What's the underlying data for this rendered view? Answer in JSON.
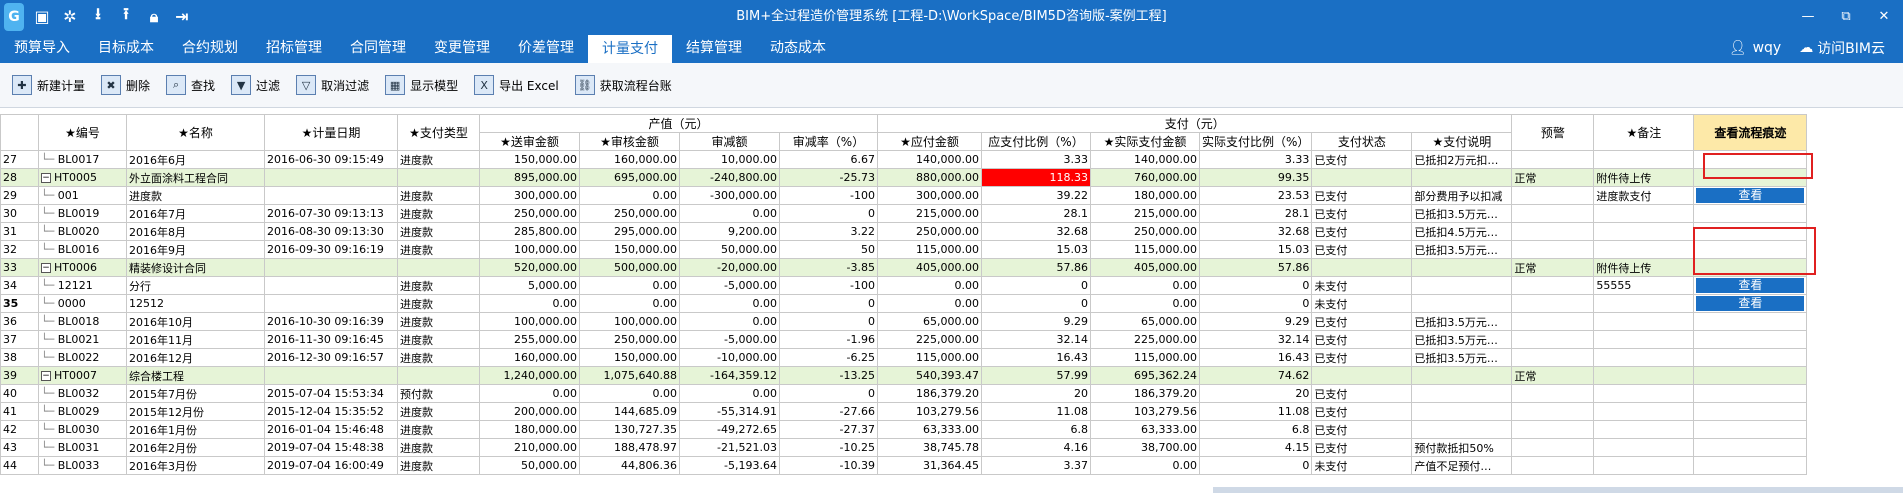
{
  "titlebar": {
    "title": "BIM+全过程造价管理系统 [工程-D:\\WorkSpace/BIM5D咨询版-案例工程]",
    "quick_access": [
      "logo-icon",
      "save-icon",
      "settings-icon",
      "download-icon",
      "upload-icon",
      "lock-icon",
      "exit-icon"
    ],
    "window_buttons": [
      "—",
      "⧉",
      "✕"
    ]
  },
  "menu": {
    "items": [
      "预算导入",
      "目标成本",
      "合约规划",
      "招标管理",
      "合同管理",
      "变更管理",
      "价差管理",
      "计量支付",
      "结算管理",
      "动态成本"
    ],
    "active": "计量支付",
    "user": "wqy",
    "visit": "访问BIM云"
  },
  "toolbar": {
    "buttons": [
      {
        "label": "新建计量",
        "icon": "new-icon"
      },
      {
        "label": "删除",
        "icon": "delete-icon"
      },
      {
        "label": "查找",
        "icon": "find-icon"
      },
      {
        "label": "过滤",
        "icon": "filter-icon"
      },
      {
        "label": "取消过滤",
        "icon": "cancel-filter-icon"
      },
      {
        "label": "显示模型",
        "icon": "model-icon"
      },
      {
        "label": "导出 Excel",
        "icon": "excel-icon"
      },
      {
        "label": "获取流程台账",
        "icon": "workflow-icon"
      }
    ]
  },
  "grid": {
    "group_headers": {
      "output": "产值（元）",
      "payment": "支付（元）"
    },
    "headers": [
      "★编号",
      "★名称",
      "★计量日期",
      "★支付类型",
      "★送审金额",
      "★审核金额",
      "审减额",
      "审减率（%）",
      "★应付金额",
      "应支付比例（%）",
      "★实际支付金额",
      "实际支付比例（%）",
      "支付状态",
      "★支付说明",
      "预警",
      "★备注",
      "查看流程痕迹"
    ],
    "rows": [
      {
        "n": "27",
        "code": "BL0017",
        "name": "2016年6月",
        "date": "2016-06-30 09:15:49",
        "type": "进度款",
        "sub": "150,000.00",
        "aud": "160,000.00",
        "red": "10,000.00",
        "rate": "6.67",
        "pay": "140,000.00",
        "pr": "3.33",
        "act": "140,000.00",
        "ar": "3.33",
        "status": "已支付",
        "desc": "已抵扣2万元扣…",
        "warn": "",
        "note": "",
        "btn": "",
        "group": false
      },
      {
        "n": "28",
        "code": "HT0005",
        "name": "外立面涂料工程合同",
        "date": "",
        "type": "",
        "sub": "895,000.00",
        "aud": "695,000.00",
        "red": "-240,800.00",
        "rate": "-25.73",
        "pay": "880,000.00",
        "pr": "118.33",
        "act": "760,000.00",
        "ar": "99.35",
        "status": "",
        "desc": "",
        "warn": "正常",
        "note": "附件待上传",
        "btn": "",
        "group": true
      },
      {
        "n": "29",
        "code": "001",
        "name": "进度款",
        "date": "",
        "type": "进度款",
        "sub": "300,000.00",
        "aud": "0.00",
        "red": "-300,000.00",
        "rate": "-100",
        "pay": "300,000.00",
        "pr": "39.22",
        "act": "180,000.00",
        "ar": "23.53",
        "status": "已支付",
        "desc": "部分费用予以扣减",
        "warn": "",
        "note": "进度款支付",
        "btn": "查看",
        "group": false
      },
      {
        "n": "30",
        "code": "BL0019",
        "name": "2016年7月",
        "date": "2016-07-30 09:13:13",
        "type": "进度款",
        "sub": "250,000.00",
        "aud": "250,000.00",
        "red": "0.00",
        "rate": "0",
        "pay": "215,000.00",
        "pr": "28.1",
        "act": "215,000.00",
        "ar": "28.1",
        "status": "已支付",
        "desc": "已抵扣3.5万元…",
        "warn": "",
        "note": "",
        "btn": "",
        "group": false
      },
      {
        "n": "31",
        "code": "BL0020",
        "name": "2016年8月",
        "date": "2016-08-30 09:13:30",
        "type": "进度款",
        "sub": "285,800.00",
        "aud": "295,000.00",
        "red": "9,200.00",
        "rate": "3.22",
        "pay": "250,000.00",
        "pr": "32.68",
        "act": "250,000.00",
        "ar": "32.68",
        "status": "已支付",
        "desc": "已抵扣4.5万元…",
        "warn": "",
        "note": "",
        "btn": "",
        "group": false
      },
      {
        "n": "32",
        "code": "BL0016",
        "name": "2016年9月",
        "date": "2016-09-30 09:16:19",
        "type": "进度款",
        "sub": "100,000.00",
        "aud": "150,000.00",
        "red": "50,000.00",
        "rate": "50",
        "pay": "115,000.00",
        "pr": "15.03",
        "act": "115,000.00",
        "ar": "15.03",
        "status": "已支付",
        "desc": "已抵扣3.5万元…",
        "warn": "",
        "note": "",
        "btn": "",
        "group": false
      },
      {
        "n": "33",
        "code": "HT0006",
        "name": "精装修设计合同",
        "date": "",
        "type": "",
        "sub": "520,000.00",
        "aud": "500,000.00",
        "red": "-20,000.00",
        "rate": "-3.85",
        "pay": "405,000.00",
        "pr": "57.86",
        "act": "405,000.00",
        "ar": "57.86",
        "status": "",
        "desc": "",
        "warn": "正常",
        "note": "附件待上传",
        "btn": "",
        "group": true
      },
      {
        "n": "34",
        "code": "12121",
        "name": "分行",
        "date": "",
        "type": "进度款",
        "sub": "5,000.00",
        "aud": "0.00",
        "red": "-5,000.00",
        "rate": "-100",
        "pay": "0.00",
        "pr": "0",
        "act": "0.00",
        "ar": "0",
        "status": "未支付",
        "desc": "",
        "warn": "",
        "note": "55555",
        "btn": "查看",
        "group": false
      },
      {
        "n": "35",
        "code": "0000",
        "name": "12512",
        "date": "",
        "type": "进度款",
        "sub": "0.00",
        "aud": "0.00",
        "red": "0.00",
        "rate": "0",
        "pay": "0.00",
        "pr": "0",
        "act": "0.00",
        "ar": "0",
        "status": "未支付",
        "desc": "",
        "warn": "",
        "note": "",
        "btn": "查看",
        "group": false
      },
      {
        "n": "36",
        "code": "BL0018",
        "name": "2016年10月",
        "date": "2016-10-30 09:16:39",
        "type": "进度款",
        "sub": "100,000.00",
        "aud": "100,000.00",
        "red": "0.00",
        "rate": "0",
        "pay": "65,000.00",
        "pr": "9.29",
        "act": "65,000.00",
        "ar": "9.29",
        "status": "已支付",
        "desc": "已抵扣3.5万元…",
        "warn": "",
        "note": "",
        "btn": "",
        "group": false
      },
      {
        "n": "37",
        "code": "BL0021",
        "name": "2016年11月",
        "date": "2016-11-30 09:16:45",
        "type": "进度款",
        "sub": "255,000.00",
        "aud": "250,000.00",
        "red": "-5,000.00",
        "rate": "-1.96",
        "pay": "225,000.00",
        "pr": "32.14",
        "act": "225,000.00",
        "ar": "32.14",
        "status": "已支付",
        "desc": "已抵扣3.5万元…",
        "warn": "",
        "note": "",
        "btn": "",
        "group": false
      },
      {
        "n": "38",
        "code": "BL0022",
        "name": "2016年12月",
        "date": "2016-12-30 09:16:57",
        "type": "进度款",
        "sub": "160,000.00",
        "aud": "150,000.00",
        "red": "-10,000.00",
        "rate": "-6.25",
        "pay": "115,000.00",
        "pr": "16.43",
        "act": "115,000.00",
        "ar": "16.43",
        "status": "已支付",
        "desc": "已抵扣3.5万元…",
        "warn": "",
        "note": "",
        "btn": "",
        "group": false
      },
      {
        "n": "39",
        "code": "HT0007",
        "name": "综合楼工程",
        "date": "",
        "type": "",
        "sub": "1,240,000.00",
        "aud": "1,075,640.88",
        "red": "-164,359.12",
        "rate": "-13.25",
        "pay": "540,393.47",
        "pr": "57.99",
        "act": "695,362.24",
        "ar": "74.62",
        "status": "",
        "desc": "",
        "warn": "正常",
        "note": "",
        "btn": "",
        "group": true
      },
      {
        "n": "40",
        "code": "BL0032",
        "name": "2015年7月份",
        "date": "2015-07-04 15:53:34",
        "type": "预付款",
        "sub": "0.00",
        "aud": "0.00",
        "red": "0.00",
        "rate": "0",
        "pay": "186,379.20",
        "pr": "20",
        "act": "186,379.20",
        "ar": "20",
        "status": "已支付",
        "desc": "",
        "warn": "",
        "note": "",
        "btn": "",
        "group": false
      },
      {
        "n": "41",
        "code": "BL0029",
        "name": "2015年12月份",
        "date": "2015-12-04 15:35:52",
        "type": "进度款",
        "sub": "200,000.00",
        "aud": "144,685.09",
        "red": "-55,314.91",
        "rate": "-27.66",
        "pay": "103,279.56",
        "pr": "11.08",
        "act": "103,279.56",
        "ar": "11.08",
        "status": "已支付",
        "desc": "",
        "warn": "",
        "note": "",
        "btn": "",
        "group": false
      },
      {
        "n": "42",
        "code": "BL0030",
        "name": "2016年1月份",
        "date": "2016-01-04 15:46:48",
        "type": "进度款",
        "sub": "180,000.00",
        "aud": "130,727.35",
        "red": "-49,272.65",
        "rate": "-27.37",
        "pay": "63,333.00",
        "pr": "6.8",
        "act": "63,333.00",
        "ar": "6.8",
        "status": "已支付",
        "desc": "",
        "warn": "",
        "note": "",
        "btn": "",
        "group": false
      },
      {
        "n": "43",
        "code": "BL0031",
        "name": "2016年2月份",
        "date": "2019-07-04 15:48:38",
        "type": "进度款",
        "sub": "210,000.00",
        "aud": "188,478.97",
        "red": "-21,521.03",
        "rate": "-10.25",
        "pay": "38,745.78",
        "pr": "4.16",
        "act": "38,700.00",
        "ar": "4.15",
        "status": "已支付",
        "desc": "预付款抵扣50%",
        "warn": "",
        "note": "",
        "btn": "",
        "group": false
      },
      {
        "n": "44",
        "code": "BL0033",
        "name": "2016年3月份",
        "date": "2019-07-04 16:00:49",
        "type": "进度款",
        "sub": "50,000.00",
        "aud": "44,806.36",
        "red": "-5,193.64",
        "rate": "-10.39",
        "pay": "31,364.45",
        "pr": "3.37",
        "act": "0.00",
        "ar": "0",
        "status": "未支付",
        "desc": "产值不足预付…",
        "warn": "",
        "note": "",
        "btn": "",
        "group": false
      }
    ]
  },
  "colors": {
    "brand": "#1a6fc4",
    "group_row": "#e6f4d7",
    "alert": "#ff0000",
    "trace_header": "#fde9a8"
  }
}
